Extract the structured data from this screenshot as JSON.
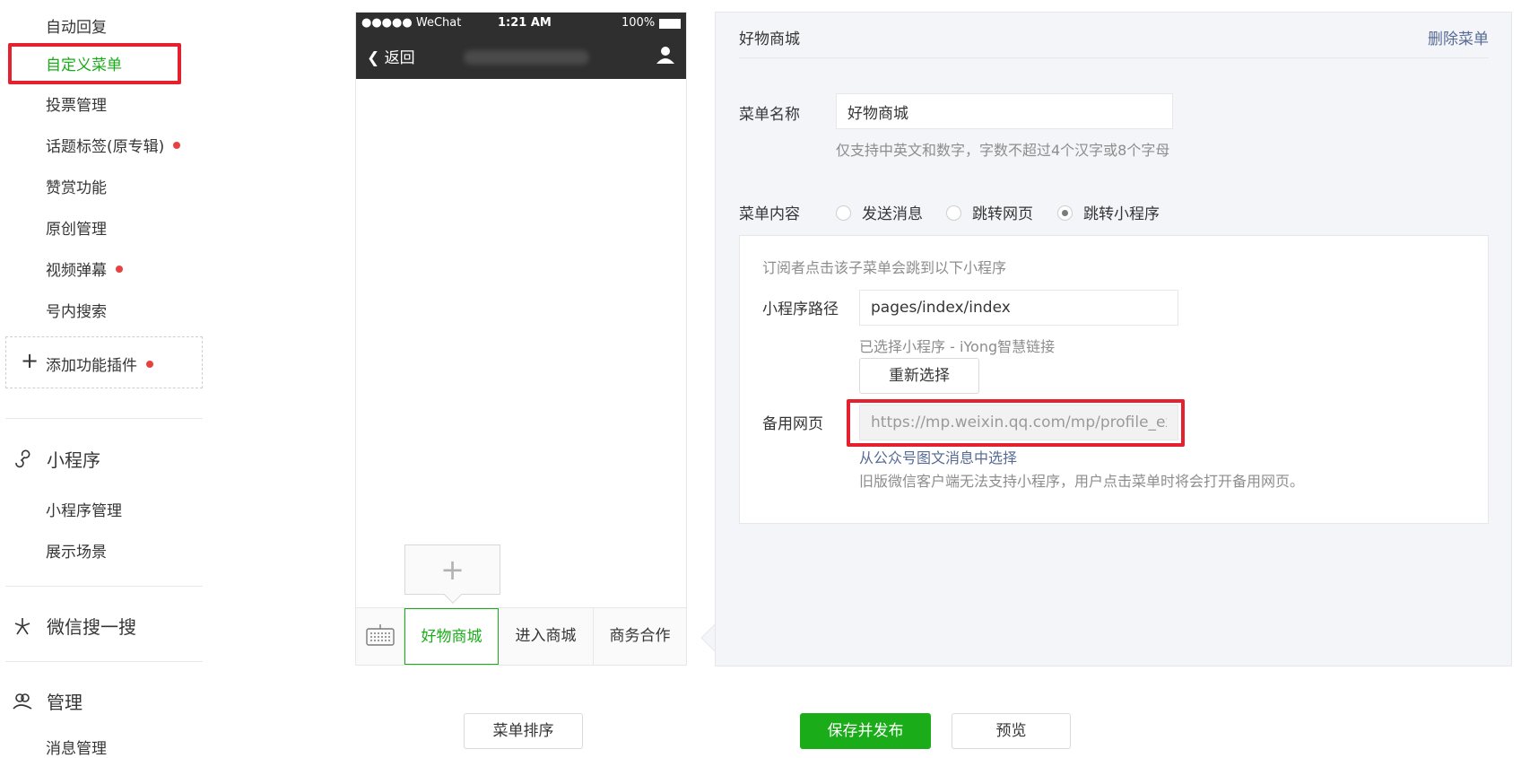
{
  "sidebar": {
    "items": [
      {
        "label": "自动回复"
      },
      {
        "label": "自定义菜单"
      },
      {
        "label": "投票管理"
      },
      {
        "label": "话题标签(原专辑)"
      },
      {
        "label": "赞赏功能"
      },
      {
        "label": "原创管理"
      },
      {
        "label": "视频弹幕"
      },
      {
        "label": "号内搜索"
      }
    ],
    "add_plugin": {
      "icon": "plus-icon",
      "label": "添加功能插件"
    },
    "groups": {
      "miniprogram": {
        "icon": "miniprogram-icon",
        "label": "小程序",
        "items": [
          {
            "label": "小程序管理"
          },
          {
            "label": "展示场景"
          }
        ]
      },
      "search": {
        "icon": "search-sparkle-icon",
        "label": "微信搜一搜"
      },
      "manage": {
        "icon": "users-icon",
        "label": "管理",
        "items": [
          {
            "label": "消息管理"
          }
        ]
      }
    },
    "accent_color": "#1aad19",
    "dot_color": "#e64340"
  },
  "phone": {
    "status": {
      "carrier": "●●●●● WeChat",
      "time": "1:21 AM",
      "battery": "100%"
    },
    "back_label": "返回",
    "submenu_add": "+",
    "menu_tabs": [
      {
        "label": "好物商城",
        "active": true
      },
      {
        "label": "进入商城"
      },
      {
        "label": "商务合作"
      }
    ]
  },
  "editor": {
    "title": "好物商城",
    "delete_label": "删除菜单",
    "name_label": "菜单名称",
    "name_value": "好物商城",
    "name_hint": "仅支持中英文和数字，字数不超过4个汉字或8个字母",
    "content_label": "菜单内容",
    "content_options": [
      {
        "label": "发送消息",
        "selected": false
      },
      {
        "label": "跳转网页",
        "selected": false
      },
      {
        "label": "跳转小程序",
        "selected": true
      }
    ],
    "mini": {
      "intro": "订阅者点击该子菜单会跳到以下小程序",
      "path_label": "小程序路径",
      "path_value": "pages/index/index",
      "selected_text": "已选择小程序 - iYong智慧链接",
      "reselect_label": "重新选择",
      "backup_label": "备用网页",
      "backup_value": "https://mp.weixin.qq.com/mp/profile_ext",
      "from_article_label": "从公众号图文消息中选择",
      "note": "旧版微信客户端无法支持小程序，用户点击菜单时将会打开备用网页。"
    }
  },
  "bottom": {
    "sort_label": "菜单排序",
    "save_label": "保存并发布",
    "preview_label": "预览"
  },
  "highlight_color": "#e5202f"
}
